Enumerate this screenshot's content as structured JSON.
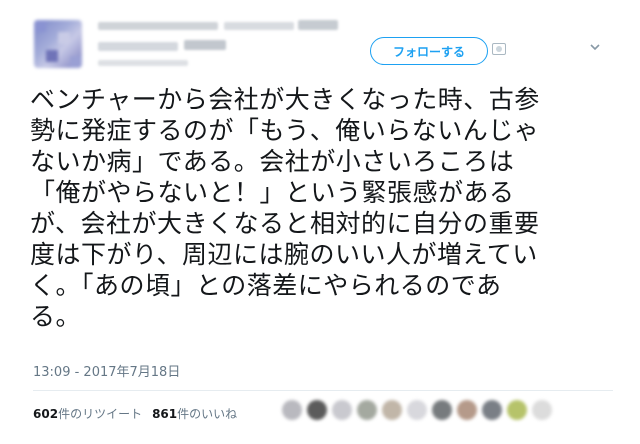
{
  "header": {
    "follow_label": "フォローする"
  },
  "tweet": {
    "text": "ベンチャーから会社が大きくなった時、古参\n勢に発症するのが「もう、俺いらないんじゃ\nないか病」である。会社が小さいろころは\n「俺がやらないと！」という緊張感がある\nが、会社が大きくなると相対的に自分の重要\n度は下がり、周辺には腕のいい人が増えてい\nく。「あの頃」との落差にやられるのであ\nる。",
    "timestamp": "13:09 - 2017年7月18日"
  },
  "stats": {
    "retweets_count": "602",
    "retweets_label": "件のリツイート",
    "likes_count": "861",
    "likes_label": "件のいいね"
  },
  "colors": {
    "accent": "#1da1f2",
    "text": "#14171a",
    "muted": "#657786"
  },
  "likers_colors": [
    "#b9b9bf",
    "#5b5b5b",
    "#c9c9cf",
    "#a4a9a0",
    "#c1b6a8",
    "#d8d8dd",
    "#777b7e",
    "#b59a8a",
    "#7a7f86",
    "#b6c36a",
    "#dcdcdc"
  ]
}
